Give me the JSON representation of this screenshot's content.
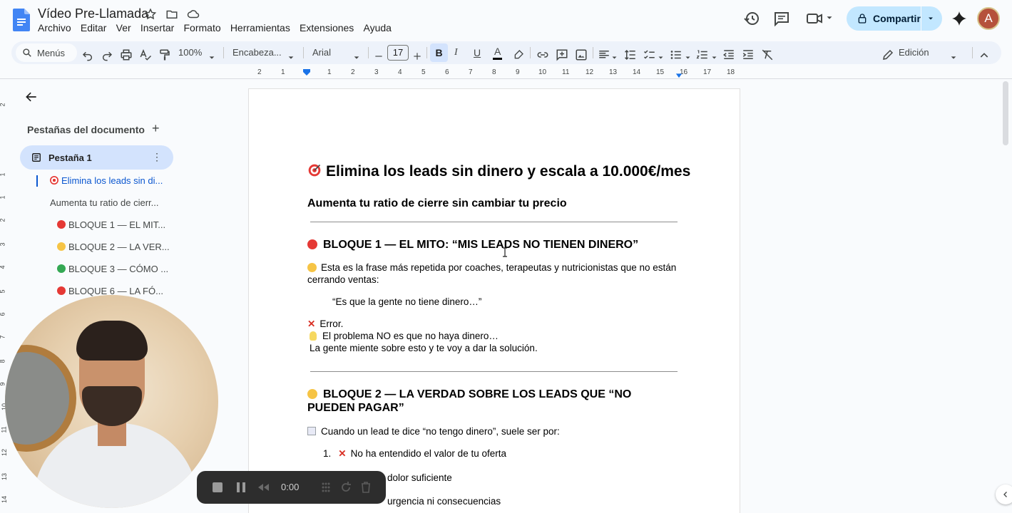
{
  "doc": {
    "title": "Vídeo Pre-Llamada"
  },
  "menu": [
    "Archivo",
    "Editar",
    "Ver",
    "Insertar",
    "Formato",
    "Herramientas",
    "Extensiones",
    "Ayuda"
  ],
  "share": {
    "label": "Compartir"
  },
  "avatar": {
    "initial": "A"
  },
  "toolbar": {
    "menus_label": "Menús",
    "zoom": "100%",
    "style": "Encabeza...",
    "font": "Arial",
    "font_size": "17",
    "bold": "B",
    "italic": "I",
    "underline": "U",
    "text_color": "A",
    "mode": "Edición"
  },
  "ruler": [
    "2",
    "1",
    "1",
    "2",
    "3",
    "4",
    "5",
    "6",
    "7",
    "8",
    "9",
    "10",
    "11",
    "12",
    "13",
    "14",
    "15",
    "16",
    "17",
    "18"
  ],
  "vruler": [
    "2",
    "1",
    "1",
    "2",
    "3",
    "4",
    "5",
    "6",
    "7",
    "8",
    "9",
    "10",
    "11",
    "12",
    "13",
    "14",
    "15"
  ],
  "sidebar": {
    "title": "Pestañas del documento",
    "plus": "+",
    "tab": "Pestaña 1",
    "tab_more": "⋮",
    "outline": [
      {
        "text": "Elimina los leads sin di...",
        "active": true,
        "icon": "🎯"
      },
      {
        "text": "Aumenta tu ratio de cierr...",
        "active": false,
        "icon": ""
      },
      {
        "text": "BLOQUE 1 — EL MIT...",
        "active": false,
        "icon": "red"
      },
      {
        "text": "BLOQUE 2 — LA VER...",
        "active": false,
        "icon": "yellow"
      },
      {
        "text": "BLOQUE 3 — CÓMO ...",
        "active": false,
        "icon": "green"
      },
      {
        "text": "BLOQUE 6 — LA FÓ...",
        "active": false,
        "icon": "red"
      }
    ]
  },
  "content": {
    "h1": "Elimina los leads sin dinero y escala a 10.000€/mes",
    "h2": "Aumenta tu ratio de cierre sin cambiar tu precio",
    "block1_title": "BLOQUE 1 — EL MITO: “MIS LEADS NO TIENEN DINERO”",
    "p1": "Esta es la frase más repetida por coaches, terapeutas y nutricionistas que no están cerrando ventas:",
    "quote": "“Es que la gente no tiene dinero…”",
    "error": "Error.",
    "problem": "El problema NO es que no haya dinero…",
    "lie": "La gente miente sobre esto y te voy a dar la solución.",
    "block2_title": "BLOQUE 2 — LA VERDAD SOBRE LOS LEADS QUE “NO PUEDEN PAGAR”",
    "p2": "Cuando un lead te dice “no tengo dinero”, suele ser por:",
    "li1_num": "1.",
    "li1": "No ha entendido el valor de tu oferta",
    "li2": "dolor suficiente",
    "li3": "urgencia ni consecuencias"
  },
  "recorder": {
    "time": "0:00"
  },
  "colors": {
    "accent": "#0b57d0",
    "share_bg": "#c2e7ff",
    "recorder_bg": "#2d2d2d"
  }
}
